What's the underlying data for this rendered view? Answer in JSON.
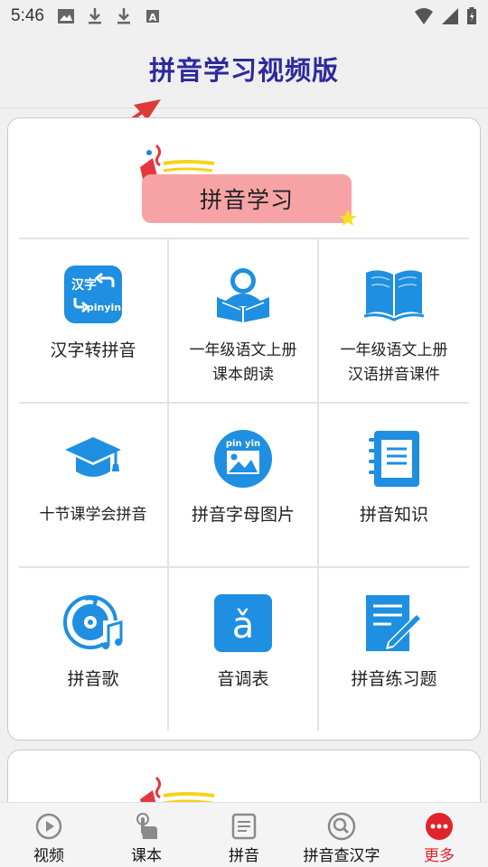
{
  "status_bar": {
    "time": "5:46",
    "icons": [
      "image-icon",
      "download-icon",
      "download-icon",
      "font-icon",
      "wifi-icon",
      "signal-icon",
      "battery-charging-icon"
    ]
  },
  "header": {
    "title": "拼音学习视频版"
  },
  "section": {
    "banner_label": "拼音学习",
    "items": [
      {
        "label": "汉字转拼音",
        "icon": "hanzi-pinyin-icon",
        "badge_top": "汉字",
        "badge_bottom": "pinyin"
      },
      {
        "label": "一年级语文上册\n课本朗读",
        "icon": "reading-person-icon"
      },
      {
        "label": "一年级语文上册\n汉语拼音课件",
        "icon": "open-book-icon"
      },
      {
        "label": "十节课学会拼音",
        "icon": "graduation-cap-icon"
      },
      {
        "label": "拼音字母图片",
        "icon": "pinyin-picture-icon",
        "badge_top": "pin yin"
      },
      {
        "label": "拼音知识",
        "icon": "notebook-icon"
      },
      {
        "label": "拼音歌",
        "icon": "music-disc-icon"
      },
      {
        "label": "音调表",
        "icon": "tone-chart-icon",
        "glyph": "ǎ"
      },
      {
        "label": "拼音练习题",
        "icon": "exercise-pencil-icon"
      }
    ]
  },
  "bottom_nav": {
    "items": [
      {
        "label": "视频",
        "icon": "play-circle-icon"
      },
      {
        "label": "课本",
        "icon": "touch-hand-icon"
      },
      {
        "label": "拼音",
        "icon": "document-icon"
      },
      {
        "label": "拼音查汉字",
        "icon": "search-icon"
      },
      {
        "label": "更多",
        "icon": "more-dots-icon"
      }
    ],
    "active_index": 4
  },
  "colors": {
    "accent_blue": "#1e8fe1",
    "title_color": "#2e2a9c",
    "banner_pink": "#f7a3a5",
    "active_red": "#e0242c"
  }
}
